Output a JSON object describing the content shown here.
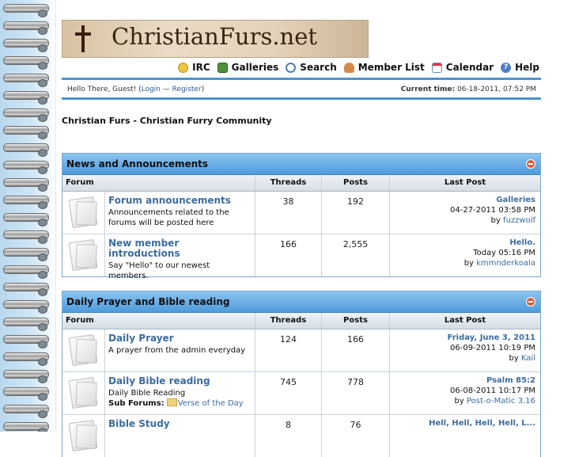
{
  "logo": {
    "text": "ChristianFurs.net"
  },
  "nav": [
    {
      "label": "IRC",
      "icon": "chat-icon"
    },
    {
      "label": "Galleries",
      "icon": "gallery-icon"
    },
    {
      "label": "Search",
      "icon": "search-icon"
    },
    {
      "label": "Member List",
      "icon": "members-icon"
    },
    {
      "label": "Calendar",
      "icon": "calendar-icon"
    },
    {
      "label": "Help",
      "icon": "help-icon"
    }
  ],
  "userbar": {
    "greeting": "Hello There, Guest! (",
    "login": "Login",
    "sep": " — ",
    "register": "Register",
    "close": ")",
    "time_label": "Current time:",
    "time_value": " 06-18-2011, 07:52 PM"
  },
  "community_title": "Christian Furs - Christian Furry Community",
  "columns": {
    "forum": "Forum",
    "threads": "Threads",
    "posts": "Posts",
    "last_post": "Last Post"
  },
  "categories": [
    {
      "title": "News and Announcements",
      "forums": [
        {
          "name": "Forum announcements",
          "desc": "Announcements related to the forums will be posted here",
          "threads": "38",
          "posts": "192",
          "last_title": "Galleries",
          "last_date": "04-27-2011 03:58 PM",
          "last_by": "by ",
          "last_user": "fuzzwolf"
        },
        {
          "name": "New member introductions",
          "desc": "Say \"Hello\" to our newest members.",
          "threads": "166",
          "posts": "2,555",
          "last_title": "Hello.",
          "last_date": "Today 05:16 PM",
          "last_by": "by ",
          "last_user": "kmmnderkoala"
        }
      ]
    },
    {
      "title": "Daily Prayer and Bible reading",
      "forums": [
        {
          "name": "Daily Prayer",
          "desc": "A prayer from the admin everyday",
          "threads": "124",
          "posts": "166",
          "last_title": "Friday, June 3, 2011",
          "last_date": "06-09-2011 10:19 PM",
          "last_by": "by ",
          "last_user": "Kail"
        },
        {
          "name": "Daily Bible reading",
          "desc": "Daily Bible Reading",
          "sub_label": "Sub Forums:",
          "sub_forum": "Verse of the Day",
          "threads": "745",
          "posts": "778",
          "last_title": "Psalm 85:2",
          "last_date": "06-08-2011 10:17 PM",
          "last_by": "by ",
          "last_user": "Post-o-Matic 3.16"
        },
        {
          "name": "Bible Study",
          "desc": "",
          "threads": "8",
          "posts": "76",
          "last_title": "Hell, Hell, Hell, Hell, L...",
          "last_date": "",
          "last_by": "",
          "last_user": ""
        }
      ]
    }
  ]
}
